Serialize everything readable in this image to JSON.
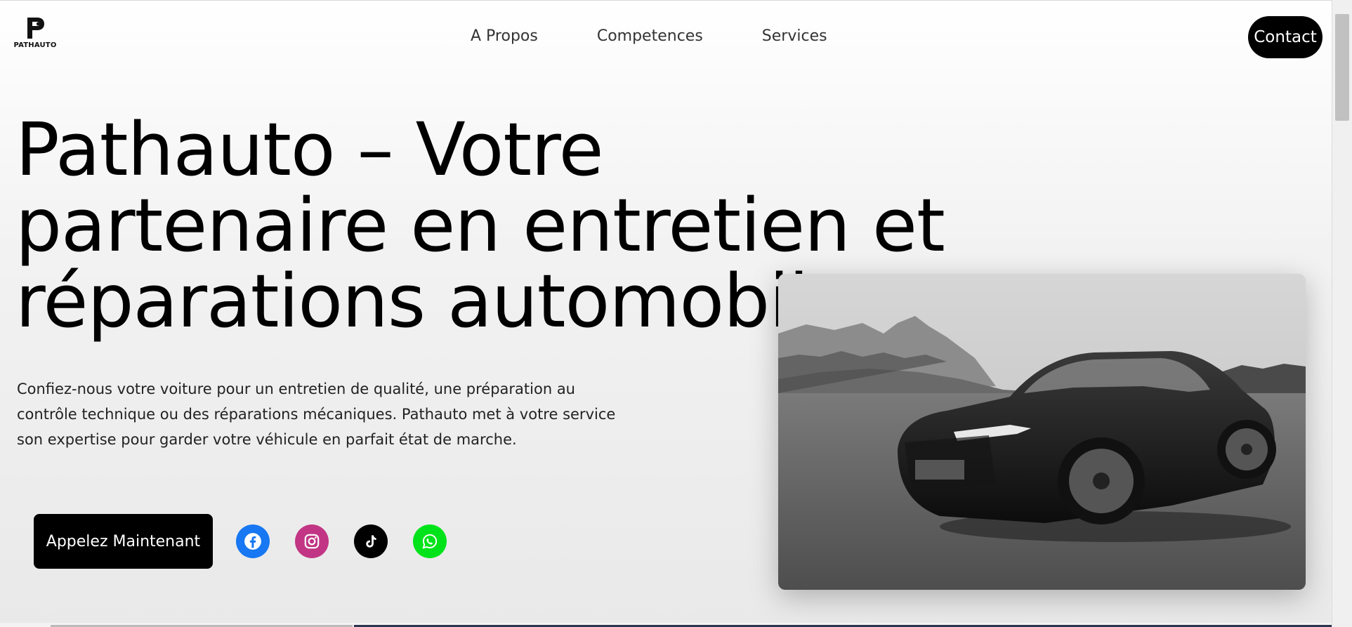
{
  "brand": {
    "logo_text": "PATHAUTO"
  },
  "nav": {
    "items": [
      "A Propos",
      "Competences",
      "Services"
    ],
    "contact_label": "Contact"
  },
  "hero": {
    "title": "Pathauto – Votre partenaire en entretien et réparations automobiles",
    "description": "Confiez-nous votre voiture pour un entretien de qualité, une préparation au contrôle technique ou des réparations mécaniques. Pathauto met à votre service son expertise pour garder votre véhicule en parfait état de marche.",
    "call_button": "Appelez Maintenant"
  },
  "social": [
    {
      "icon": "facebook-icon",
      "color": "#1877f2"
    },
    {
      "icon": "instagram-icon",
      "color": "#c13584"
    },
    {
      "icon": "tiktok-icon",
      "color": "#000000"
    },
    {
      "icon": "whatsapp-icon",
      "color": "#00e31a"
    }
  ],
  "colors": {
    "accent": "#000000",
    "text": "#111111"
  }
}
